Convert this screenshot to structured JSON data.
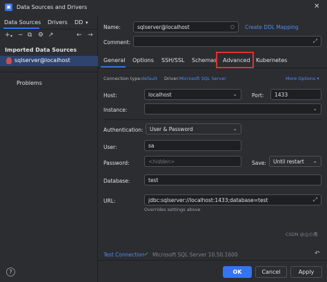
{
  "window": {
    "title": "Data Sources and Drivers"
  },
  "sidebar": {
    "tabs": [
      "Data Sources",
      "Drivers",
      "DD"
    ],
    "tools": {
      "add": "+",
      "remove": "−",
      "copy": "⧉",
      "settings": "⚙",
      "open": "↗",
      "back": "←",
      "forward": "→"
    },
    "section_label": "Imported Data Sources",
    "selected_item": "sqlserver@localhost",
    "problems_label": "Problems"
  },
  "header": {
    "name_label": "Name:",
    "name_value": "sqlserver@localhost",
    "create_ddl_link": "Create DDL Mapping",
    "comment_label": "Comment:"
  },
  "settings_tabs": [
    "General",
    "Options",
    "SSH/SSL",
    "Schemas",
    "Advanced",
    "Kubernetes"
  ],
  "general": {
    "connection_type_label": "Connection type:",
    "connection_type_value": "default",
    "driver_label": "Driver:",
    "driver_value": "Microsoft SQL Server",
    "more_options": "More Options",
    "host_label": "Host:",
    "host_value": "localhost",
    "port_label": "Port:",
    "port_value": "1433",
    "instance_label": "Instance:",
    "instance_value": "",
    "authentication_label": "Authentication:",
    "authentication_value": "User & Password",
    "user_label": "User:",
    "user_value": "sa",
    "password_label": "Password:",
    "password_value": "<hidden>",
    "save_label": "Save:",
    "save_value": "Until restart",
    "database_label": "Database:",
    "database_value": "test",
    "url_label": "URL:",
    "url_value": "jdbc:sqlserver://localhost:1433;database=test",
    "url_note": "Overrides settings above"
  },
  "footer": {
    "test_connection": "Test Connection",
    "test_status": "Microsoft SQL Server 10.50.1600",
    "ok": "OK",
    "cancel": "Cancel",
    "apply": "Apply",
    "watermark": "CSDN @山小鹰"
  },
  "colors": {
    "accent": "#3574f0",
    "highlight_box": "#e03131",
    "success": "#5fb865",
    "link": "#548af7"
  }
}
